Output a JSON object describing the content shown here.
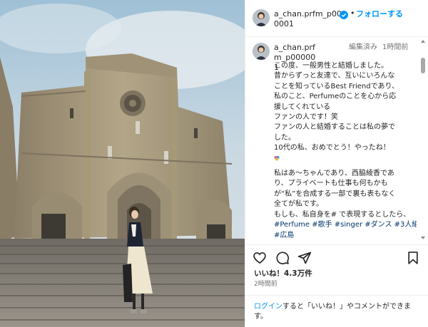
{
  "post": {
    "username": "a_chan.prfm_p000001",
    "follow_label": "フォローする",
    "dot": "•",
    "colors": {
      "link": "#0095f6",
      "hashtag": "#00376b",
      "meta": "#737373",
      "text": "#262626",
      "verified": "#0095f6"
    }
  },
  "caption": {
    "username": "a_chan.prfm_p000001",
    "edited": "編集済み",
    "time": "1時間前",
    "lines": [
      "この度、一般男性と結婚しました。",
      "昔からずっと友達で、互いにいろんな",
      "ことを知っているBest Friendであり、",
      "私のこと、Perfumeのことを心から応",
      "援してくれている",
      "ファンの人です！笑",
      "ファンの人と結婚することは私の夢で",
      "した。",
      "10代の私、おめでとう！やったね！"
    ],
    "lines2": [
      "私はあ〜ちゃんであり、西脇綾香であ",
      "り、プライベートも仕事も何もかも",
      "が“私”を合成する一部で裏も表もなく",
      "全てが私です。",
      "もしも、私自身を# で表現するとしたら、"
    ],
    "hashtags_line1": "#Perfume #歌手 #singer #ダンス #3人組",
    "hashtags_line2": "#広島"
  },
  "icons": [
    "verified-icon",
    "heart-icon",
    "comment-icon",
    "share-icon",
    "bookmark-icon",
    "emoji-icon"
  ],
  "likes": "いいね！4.3万件",
  "time_ago": "2時間前",
  "login": {
    "link": "ログイン",
    "rest": "すると「いいね！」やコメントができます。"
  }
}
